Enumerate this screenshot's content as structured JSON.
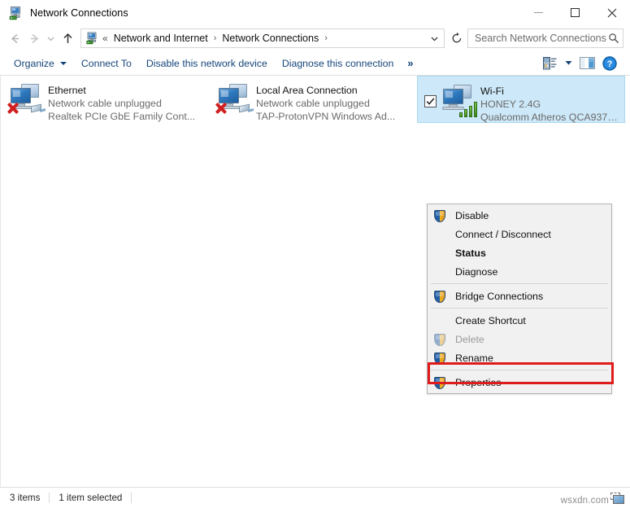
{
  "window": {
    "title": "Network Connections",
    "icon": "network-connections-icon",
    "controls": {
      "minimize": "minimize-button",
      "maximize": "maximize-button",
      "close": "close-button"
    }
  },
  "nav": {
    "back_label": "Back",
    "forward_label": "Forward",
    "recent_label": "Recent locations",
    "up_label": "Up",
    "refresh_label": "Refresh",
    "breadcrumb_icon": "network-connections-icon",
    "breadcrumb_prefix": "«",
    "breadcrumb": [
      {
        "label": "Network and Internet"
      },
      {
        "label": "Network Connections"
      }
    ],
    "separator": "›",
    "dropdown": "⌄"
  },
  "search": {
    "placeholder": "Search Network Connections",
    "value": "",
    "icon": "search-icon"
  },
  "toolbar": {
    "items": [
      {
        "label": "Organize",
        "has_caret": true
      },
      {
        "label": "Connect To",
        "has_caret": false
      },
      {
        "label": "Disable this network device",
        "has_caret": false
      },
      {
        "label": "Diagnose this connection",
        "has_caret": false
      }
    ],
    "overflow": "»",
    "right_icons": [
      {
        "name": "change-view-icon"
      },
      {
        "name": "view-dropdown-caret"
      },
      {
        "name": "preview-pane-icon"
      },
      {
        "name": "help-icon",
        "glyph": "?"
      }
    ]
  },
  "connections": [
    {
      "name": "Ethernet",
      "status": "Network cable unplugged",
      "device": "Realtek PCIe GbE Family Cont...",
      "selected": false,
      "checked": false,
      "state": "unplugged"
    },
    {
      "name": "Local Area Connection",
      "status": "Network cable unplugged",
      "device": "TAP-ProtonVPN Windows Ad...",
      "selected": false,
      "checked": false,
      "state": "unplugged"
    },
    {
      "name": "Wi-Fi",
      "status": "HONEY 2.4G",
      "device": "Qualcomm Atheros QCA9377...",
      "selected": true,
      "checked": true,
      "state": "connected"
    }
  ],
  "context_menu": {
    "items": [
      {
        "label": "Disable",
        "shield": true,
        "disabled": false,
        "bold": false,
        "separator_after": false
      },
      {
        "label": "Connect / Disconnect",
        "shield": false,
        "disabled": false,
        "bold": false,
        "separator_after": false
      },
      {
        "label": "Status",
        "shield": false,
        "disabled": false,
        "bold": true,
        "separator_after": false
      },
      {
        "label": "Diagnose",
        "shield": false,
        "disabled": false,
        "bold": false,
        "separator_after": true
      },
      {
        "label": "Bridge Connections",
        "shield": true,
        "disabled": false,
        "bold": false,
        "separator_after": true
      },
      {
        "label": "Create Shortcut",
        "shield": false,
        "disabled": false,
        "bold": false,
        "separator_after": false
      },
      {
        "label": "Delete",
        "shield": true,
        "disabled": true,
        "bold": false,
        "separator_after": false
      },
      {
        "label": "Rename",
        "shield": true,
        "disabled": false,
        "bold": false,
        "separator_after": true
      },
      {
        "label": "Properties",
        "shield": true,
        "disabled": false,
        "bold": false,
        "separator_after": false
      }
    ],
    "highlighted_item": "Properties",
    "highlight_color": "#e01b1b"
  },
  "statusbar": {
    "item_count": "3 items",
    "selection": "1 item selected"
  },
  "watermark": {
    "text": "wsxdn.com"
  },
  "colors": {
    "selection_fill": "#cde8f8",
    "selection_border": "#a8d8f0",
    "menu_bg": "#f1f1f1",
    "link_blue": "#15457a",
    "annotation_red": "#e01b1b",
    "signal_green": "#3f8f21",
    "error_red": "#d21f1f"
  }
}
